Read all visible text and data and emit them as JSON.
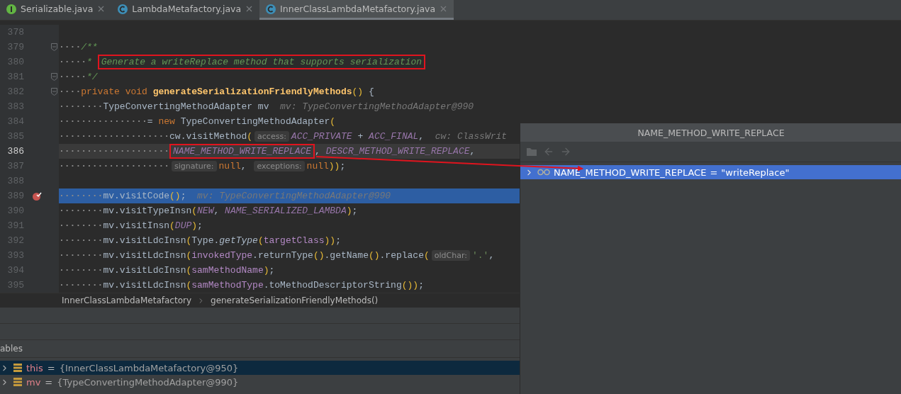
{
  "tabs": [
    {
      "label": "Serializable.java",
      "kind": "interface",
      "selected": false
    },
    {
      "label": "LambdaMetafactory.java",
      "kind": "class",
      "selected": false
    },
    {
      "label": "InnerClassLambdaMetafactory.java",
      "kind": "class",
      "selected": true
    }
  ],
  "code_lines": [
    {
      "number": "378",
      "caret_line": false,
      "execution": false,
      "breakpoint": false,
      "fold": false
    },
    {
      "number": "379",
      "caret_line": false,
      "execution": false,
      "breakpoint": false,
      "fold": true,
      "tokens": [
        {
          "kind": "ws",
          "text": "····"
        },
        {
          "kind": "doc",
          "text": "/**"
        }
      ]
    },
    {
      "number": "380",
      "caret_line": false,
      "execution": false,
      "breakpoint": false,
      "fold": false,
      "tokens": [
        {
          "kind": "ws",
          "text": "·····"
        },
        {
          "kind": "doc",
          "text": "* "
        },
        {
          "kind": "doc",
          "text": "Generate a writeReplace method that supports serialization",
          "boxed": true
        }
      ]
    },
    {
      "number": "381",
      "caret_line": false,
      "execution": false,
      "breakpoint": false,
      "fold": true,
      "tokens": [
        {
          "kind": "ws",
          "text": "·····"
        },
        {
          "kind": "doc",
          "text": "*/"
        }
      ]
    },
    {
      "number": "382",
      "caret_line": false,
      "execution": false,
      "breakpoint": false,
      "fold": true,
      "tokens": [
        {
          "kind": "ws",
          "text": "····"
        },
        {
          "kind": "keyword",
          "text": "private void "
        },
        {
          "kind": "decl",
          "text": "generateSerializationFriendlyMethods"
        },
        {
          "kind": "paren",
          "text": "()"
        },
        {
          "kind": "plain",
          "text": " {"
        }
      ]
    },
    {
      "number": "383",
      "caret_line": false,
      "execution": false,
      "breakpoint": false,
      "fold": false,
      "tokens": [
        {
          "kind": "ws",
          "text": "········"
        },
        {
          "kind": "plain",
          "text": "TypeConvertingMethodAdapter mv  "
        },
        {
          "kind": "debug",
          "text": "mv: TypeConvertingMethodAdapter@990"
        }
      ]
    },
    {
      "number": "384",
      "caret_line": false,
      "execution": false,
      "breakpoint": false,
      "fold": false,
      "tokens": [
        {
          "kind": "ws",
          "text": "················"
        },
        {
          "kind": "plain",
          "text": "= "
        },
        {
          "kind": "keyword",
          "text": "new "
        },
        {
          "kind": "plain",
          "text": "TypeConvertingMethodAdapter"
        },
        {
          "kind": "paren",
          "text": "("
        }
      ]
    },
    {
      "number": "385",
      "caret_line": false,
      "execution": false,
      "breakpoint": false,
      "fold": false,
      "tokens": [
        {
          "kind": "ws",
          "text": "····················"
        },
        {
          "kind": "plain",
          "text": "cw.visitMethod"
        },
        {
          "kind": "paren",
          "text": "("
        },
        {
          "kind": "hint",
          "text": "access:"
        },
        {
          "kind": "field",
          "text": "ACC_PRIVATE"
        },
        {
          "kind": "plain",
          "text": " + "
        },
        {
          "kind": "field",
          "text": "ACC_FINAL"
        },
        {
          "kind": "plain",
          "text": ",  "
        },
        {
          "kind": "debug",
          "text": "cw: ClassWrit"
        }
      ]
    },
    {
      "number": "386",
      "caret_line": true,
      "execution": false,
      "breakpoint": false,
      "fold": false,
      "tokens": [
        {
          "kind": "ws",
          "text": "····················"
        },
        {
          "kind": "field",
          "text": "NAME_METHOD_WRITE_REPLACE",
          "boxed": true
        },
        {
          "kind": "plain",
          "text": ", "
        },
        {
          "kind": "field",
          "text": "DESCR_METHOD_WRITE_REPLACE"
        },
        {
          "kind": "plain",
          "text": ","
        }
      ]
    },
    {
      "number": "387",
      "caret_line": false,
      "execution": false,
      "breakpoint": false,
      "fold": false,
      "tokens": [
        {
          "kind": "ws",
          "text": "····················"
        },
        {
          "kind": "hint",
          "text": "signature:"
        },
        {
          "kind": "keyword",
          "text": "null"
        },
        {
          "kind": "plain",
          "text": ", "
        },
        {
          "kind": "hint",
          "text": "exceptions:"
        },
        {
          "kind": "keyword",
          "text": "null"
        },
        {
          "kind": "paren",
          "text": "))"
        },
        {
          "kind": "plain",
          "text": ";"
        }
      ]
    },
    {
      "number": "388",
      "caret_line": false,
      "execution": false,
      "breakpoint": false,
      "fold": false
    },
    {
      "number": "389",
      "caret_line": false,
      "execution": true,
      "breakpoint": true,
      "fold": false,
      "tokens": [
        {
          "kind": "ws",
          "text": "········"
        },
        {
          "kind": "plain",
          "text": "mv.visitCode"
        },
        {
          "kind": "paren",
          "text": "()"
        },
        {
          "kind": "plain",
          "text": ";  "
        },
        {
          "kind": "debug",
          "text": "mv: TypeConvertingMethodAdapter@990"
        }
      ]
    },
    {
      "number": "390",
      "caret_line": false,
      "execution": false,
      "breakpoint": false,
      "fold": false,
      "tokens": [
        {
          "kind": "ws",
          "text": "········"
        },
        {
          "kind": "plain",
          "text": "mv.visitTypeInsn"
        },
        {
          "kind": "paren",
          "text": "("
        },
        {
          "kind": "field",
          "text": "NEW"
        },
        {
          "kind": "plain",
          "text": ", "
        },
        {
          "kind": "field",
          "text": "NAME_SERIALIZED_LAMBDA"
        },
        {
          "kind": "paren",
          "text": ")"
        },
        {
          "kind": "plain",
          "text": ";"
        }
      ]
    },
    {
      "number": "391",
      "caret_line": false,
      "execution": false,
      "breakpoint": false,
      "fold": false,
      "tokens": [
        {
          "kind": "ws",
          "text": "········"
        },
        {
          "kind": "plain",
          "text": "mv.visitInsn"
        },
        {
          "kind": "paren",
          "text": "("
        },
        {
          "kind": "field",
          "text": "DUP"
        },
        {
          "kind": "paren",
          "text": ")"
        },
        {
          "kind": "plain",
          "text": ";"
        }
      ]
    },
    {
      "number": "392",
      "caret_line": false,
      "execution": false,
      "breakpoint": false,
      "fold": false,
      "tokens": [
        {
          "kind": "ws",
          "text": "········"
        },
        {
          "kind": "plain",
          "text": "mv.visitLdcInsn"
        },
        {
          "kind": "paren",
          "text": "("
        },
        {
          "kind": "plain",
          "text": "Type."
        },
        {
          "kind": "static",
          "text": "getType"
        },
        {
          "kind": "paren",
          "text": "("
        },
        {
          "kind": "local",
          "text": "targetClass"
        },
        {
          "kind": "paren",
          "text": "))"
        },
        {
          "kind": "plain",
          "text": ";"
        }
      ]
    },
    {
      "number": "393",
      "caret_line": false,
      "execution": false,
      "breakpoint": false,
      "fold": false,
      "tokens": [
        {
          "kind": "ws",
          "text": "········"
        },
        {
          "kind": "plain",
          "text": "mv.visitLdcInsn"
        },
        {
          "kind": "paren",
          "text": "("
        },
        {
          "kind": "local",
          "text": "invokedType"
        },
        {
          "kind": "plain",
          "text": ".returnType"
        },
        {
          "kind": "paren",
          "text": "()"
        },
        {
          "kind": "plain",
          "text": ".getName"
        },
        {
          "kind": "paren",
          "text": "()"
        },
        {
          "kind": "plain",
          "text": ".replace"
        },
        {
          "kind": "paren",
          "text": "("
        },
        {
          "kind": "hint",
          "text": "oldChar:"
        },
        {
          "kind": "string",
          "text": "'.'"
        },
        {
          "kind": "plain",
          "text": ","
        }
      ]
    },
    {
      "number": "394",
      "caret_line": false,
      "execution": false,
      "breakpoint": false,
      "fold": false,
      "tokens": [
        {
          "kind": "ws",
          "text": "········"
        },
        {
          "kind": "plain",
          "text": "mv.visitLdcInsn"
        },
        {
          "kind": "paren",
          "text": "("
        },
        {
          "kind": "local",
          "text": "samMethodName"
        },
        {
          "kind": "paren",
          "text": ")"
        },
        {
          "kind": "plain",
          "text": ";"
        }
      ]
    },
    {
      "number": "395",
      "caret_line": false,
      "execution": false,
      "breakpoint": false,
      "fold": false,
      "tokens": [
        {
          "kind": "ws",
          "text": "········"
        },
        {
          "kind": "plain",
          "text": "mv.visitLdcInsn"
        },
        {
          "kind": "paren",
          "text": "("
        },
        {
          "kind": "local",
          "text": "samMethodType"
        },
        {
          "kind": "plain",
          "text": ".toMethodDescriptorString"
        },
        {
          "kind": "paren",
          "text": "())"
        },
        {
          "kind": "plain",
          "text": ";"
        }
      ]
    }
  ],
  "breadcrumbs": [
    "InnerClassLambdaMetafactory",
    "generateSerializationFriendlyMethods()"
  ],
  "variables": {
    "header": "ables",
    "rows": [
      {
        "name": "this",
        "separator": "=",
        "value": "{InnerClassLambdaMetafactory@950}",
        "selected": true
      },
      {
        "name": "mv",
        "separator": "=",
        "value": "{TypeConvertingMethodAdapter@990}",
        "selected": false
      }
    ]
  },
  "popup": {
    "title": "NAME_METHOD_WRITE_REPLACE",
    "toolbar": [
      {
        "kind": "folder",
        "disabled": true
      },
      {
        "kind": "back",
        "disabled": true
      },
      {
        "kind": "forward",
        "disabled": true
      }
    ],
    "rows": [
      {
        "name": "NAME_METHOD_WRITE_REPLACE",
        "separator": "=",
        "value": "\"writeReplace\"",
        "selected": true
      }
    ]
  }
}
